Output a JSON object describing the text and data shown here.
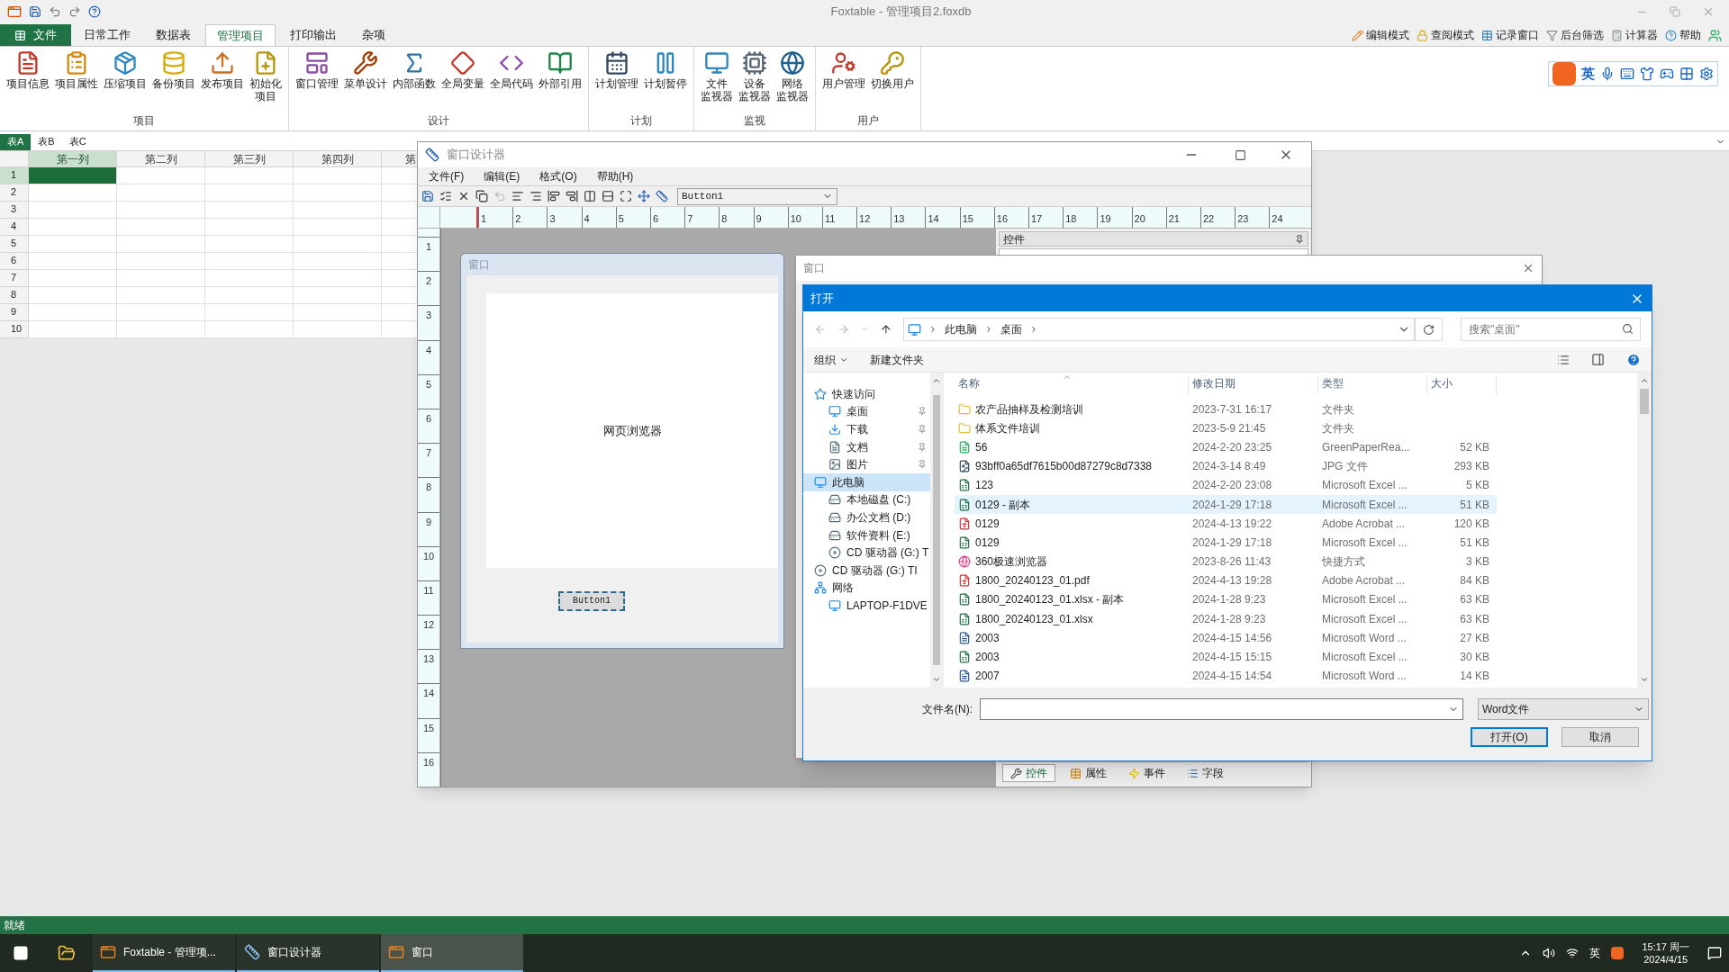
{
  "app": {
    "title": "Foxtable - 管理项目2.foxdb",
    "file_tab": "文件",
    "tabs": [
      {
        "label": "日常工作",
        "selected": false
      },
      {
        "label": "数据表",
        "selected": false
      },
      {
        "label": "管理项目",
        "selected": true
      },
      {
        "label": "打印输出",
        "selected": false
      },
      {
        "label": "杂项",
        "selected": false
      }
    ],
    "right_tools": [
      "编辑模式",
      "查阅模式",
      "记录窗口",
      "后台筛选",
      "计算器",
      "帮助"
    ],
    "groups": [
      {
        "label": "项目",
        "items": [
          [
            "项目信息"
          ],
          [
            "项目属性"
          ],
          [
            "压缩项目"
          ],
          [
            "备份项目"
          ],
          [
            "发布项目"
          ],
          [
            "初始化",
            "项目"
          ]
        ]
      },
      {
        "label": "设计",
        "items": [
          [
            "窗口管理"
          ],
          [
            "菜单设计"
          ],
          [
            "内部函数"
          ],
          [
            "全局变量"
          ],
          [
            "全局代码"
          ],
          [
            "外部引用"
          ]
        ]
      },
      {
        "label": "计划",
        "items": [
          [
            "计划管理"
          ],
          [
            "计划暂停"
          ]
        ]
      },
      {
        "label": "监视",
        "items": [
          [
            "文件",
            "监视器"
          ],
          [
            "设备",
            "监视器"
          ],
          [
            "网络",
            "监视器"
          ]
        ]
      },
      {
        "label": "用户",
        "items": [
          [
            "用户管理"
          ],
          [
            "切换用户"
          ]
        ]
      }
    ],
    "ime_label": "英"
  },
  "sheet_tabs": [
    {
      "label": "表A",
      "selected": true
    },
    {
      "label": "表B",
      "selected": false
    },
    {
      "label": "表C",
      "selected": false
    }
  ],
  "grid": {
    "columns": [
      {
        "label": "第一列",
        "selected": true
      },
      {
        "label": "第二列",
        "selected": false
      },
      {
        "label": "第三列",
        "selected": false
      },
      {
        "label": "第四列",
        "selected": false
      },
      {
        "label": "第",
        "selected": false
      }
    ],
    "rows": [
      {
        "label": "1",
        "selected": true
      },
      {
        "label": "2",
        "selected": false
      },
      {
        "label": "3",
        "selected": false
      },
      {
        "label": "4",
        "selected": false
      },
      {
        "label": "5",
        "selected": false
      },
      {
        "label": "6",
        "selected": false
      },
      {
        "label": "7",
        "selected": false
      },
      {
        "label": "8",
        "selected": false
      },
      {
        "label": "9",
        "selected": false
      },
      {
        "label": "10",
        "selected": false
      }
    ]
  },
  "designer": {
    "title": "窗口设计器",
    "menu": [
      "文件(F)",
      "编辑(E)",
      "格式(O)",
      "帮助(H)"
    ],
    "control_select": "Button1",
    "ruler_h": [
      "1",
      "2",
      "3",
      "4",
      "5",
      "6",
      "7",
      "8",
      "9",
      "10",
      "11",
      "12",
      "13",
      "14",
      "15",
      "16",
      "17",
      "18",
      "19",
      "20",
      "21",
      "22",
      "23",
      "24"
    ],
    "ruler_v": [
      "1",
      "2",
      "3",
      "4",
      "5",
      "6",
      "7",
      "8",
      "9",
      "10",
      "11",
      "12",
      "13",
      "14",
      "15",
      "16"
    ],
    "form": {
      "title": "窗口",
      "browser_label": "网页浏览器",
      "button": "Button1"
    },
    "panel_title": "控件",
    "panel_tabs": [
      {
        "label": "控件",
        "selected": true
      },
      {
        "label": "属性",
        "selected": false
      },
      {
        "label": "事件",
        "selected": false
      },
      {
        "label": "字段",
        "selected": false
      }
    ]
  },
  "back_window": {
    "title": "窗口"
  },
  "open_dialog": {
    "title": "打开",
    "path": [
      "此电脑",
      "桌面"
    ],
    "search": {
      "placeholder": "搜索\"桌面\""
    },
    "commands": [
      "组织",
      "新建文件夹"
    ],
    "nav": [
      {
        "label": "快速访问",
        "kind": "star",
        "selected": false,
        "children": [
          {
            "label": "桌面",
            "kind": "desktop",
            "selected": false,
            "pinned": true
          },
          {
            "label": "下载",
            "kind": "download",
            "selected": false,
            "pinned": true
          },
          {
            "label": "文档",
            "kind": "document",
            "selected": false,
            "pinned": true
          },
          {
            "label": "图片",
            "kind": "picture",
            "selected": false,
            "pinned": true
          }
        ]
      },
      {
        "label": "此电脑",
        "kind": "pc",
        "selected": true,
        "children": [
          {
            "label": "本地磁盘 (C:)",
            "kind": "drive",
            "selected": false,
            "pinned": false
          },
          {
            "label": "办公文档 (D:)",
            "kind": "drive",
            "selected": false,
            "pinned": false
          },
          {
            "label": "软件资料 (E:)",
            "kind": "drive",
            "selected": false,
            "pinned": false
          },
          {
            "label": "CD 驱动器 (G:) T",
            "kind": "cd",
            "selected": false,
            "pinned": false
          }
        ]
      },
      {
        "label": "CD 驱动器 (G:) TI",
        "kind": "cd",
        "selected": false
      },
      {
        "label": "网络",
        "kind": "network",
        "selected": false,
        "children": [
          {
            "label": "LAPTOP-F1DVE",
            "kind": "pc",
            "selected": false,
            "pinned": false
          }
        ]
      }
    ],
    "columns": [
      "名称",
      "修改日期",
      "类型",
      "大小"
    ],
    "files": [
      {
        "name": "农产品抽样及检测培训",
        "date": "2023-7-31 16:17",
        "type": "文件夹",
        "kind": "folder",
        "selected": false
      },
      {
        "name": "体系文件培训",
        "date": "2023-5-9 21:45",
        "type": "文件夹",
        "kind": "folder",
        "selected": false
      },
      {
        "name": "56",
        "date": "2024-2-20 23:25",
        "type": "GreenPaperRea...",
        "size": "52 KB",
        "kind": "app",
        "selected": false
      },
      {
        "name": "93bff0a65df7615b00d87279c8d7338",
        "date": "2024-3-14 8:49",
        "type": "JPG 文件",
        "size": "293 KB",
        "kind": "image",
        "selected": false
      },
      {
        "name": "123",
        "date": "2024-2-20 23:08",
        "type": "Microsoft Excel ...",
        "size": "5 KB",
        "kind": "excel",
        "selected": false
      },
      {
        "name": "0129 - 副本",
        "date": "2024-1-29 17:18",
        "type": "Microsoft Excel ...",
        "size": "51 KB",
        "kind": "excel",
        "selected": true
      },
      {
        "name": "0129",
        "date": "2024-4-13 19:22",
        "type": "Adobe Acrobat ...",
        "size": "120 KB",
        "kind": "pdf",
        "selected": false
      },
      {
        "name": "0129",
        "date": "2024-1-29 17:18",
        "type": "Microsoft Excel ...",
        "size": "51 KB",
        "kind": "excel",
        "selected": false
      },
      {
        "name": "360极速浏览器",
        "date": "2023-8-26 11:43",
        "type": "快捷方式",
        "size": "3 KB",
        "kind": "browser",
        "selected": false
      },
      {
        "name": "1800_20240123_01.pdf",
        "date": "2024-4-13 19:28",
        "type": "Adobe Acrobat ...",
        "size": "84 KB",
        "kind": "pdf",
        "selected": false
      },
      {
        "name": "1800_20240123_01.xlsx - 副本",
        "date": "2024-1-28 9:23",
        "type": "Microsoft Excel ...",
        "size": "63 KB",
        "kind": "excel",
        "selected": false
      },
      {
        "name": "1800_20240123_01.xlsx",
        "date": "2024-1-28 9:23",
        "type": "Microsoft Excel ...",
        "size": "63 KB",
        "kind": "excel",
        "selected": false
      },
      {
        "name": "2003",
        "date": "2024-4-15 14:56",
        "type": "Microsoft Word ...",
        "size": "27 KB",
        "kind": "word",
        "selected": false
      },
      {
        "name": "2003",
        "date": "2024-4-15 15:15",
        "type": "Microsoft Excel ...",
        "size": "30 KB",
        "kind": "excel",
        "selected": false
      },
      {
        "name": "2007",
        "date": "2024-4-15 14:54",
        "type": "Microsoft Word ...",
        "size": "14 KB",
        "kind": "word",
        "selected": false
      }
    ],
    "filename_label": "文件名(N):",
    "filetype": "Word文件",
    "buttons": [
      "打开(O)",
      "取消"
    ]
  },
  "status_bar": "就绪",
  "taskbar": {
    "items": [
      {
        "label": "Foxtable - 管理项...",
        "kind": "fox",
        "selected": false
      },
      {
        "label": "窗口设计器",
        "kind": "designer",
        "selected": false
      },
      {
        "label": "窗口",
        "kind": "fox",
        "selected": true
      }
    ],
    "ime": "英",
    "time": "15:17 周一",
    "date": "2024/4/15"
  }
}
